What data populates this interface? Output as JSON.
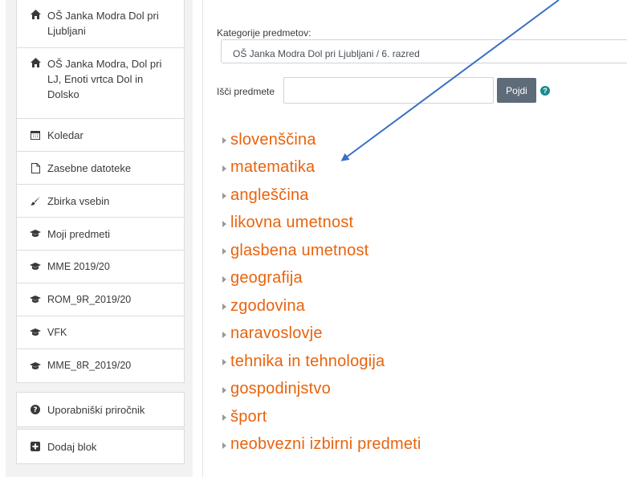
{
  "sidebar": {
    "items": [
      {
        "label": "OŠ Janka Modra Dol pri Ljubljani",
        "icon": "home-icon"
      },
      {
        "label": "OŠ Janka Modra, Dol pri LJ, Enoti vrtca Dol in Dolsko",
        "icon": "home-icon"
      },
      {
        "label": "Koledar",
        "icon": "calendar-icon"
      },
      {
        "label": "Zasebne datoteke",
        "icon": "file-icon"
      },
      {
        "label": "Zbirka vsebin",
        "icon": "paintbrush-icon"
      },
      {
        "label": "Moji predmeti",
        "icon": "graduation-cap-icon"
      },
      {
        "label": "MME 2019/20",
        "icon": "graduation-cap-icon"
      },
      {
        "label": "ROM_9R_2019/20",
        "icon": "graduation-cap-icon"
      },
      {
        "label": "VFK",
        "icon": "graduation-cap-icon"
      },
      {
        "label": "MME_8R_2019/20",
        "icon": "graduation-cap-icon"
      }
    ],
    "bottom_items": [
      {
        "label": "Uporabniški priročnik",
        "icon": "question-circle-icon"
      },
      {
        "label": "Dodaj blok",
        "icon": "plus-square-icon"
      }
    ]
  },
  "main": {
    "category_label": "Kategorije predmetov:",
    "category_value": "OŠ Janka Modra Dol pri Ljubljani / 6. razred",
    "search_label": "Išči predmete",
    "search_value": "",
    "search_button": "Pojdi",
    "courses": [
      "slovenščina",
      "matematika",
      "angleščina",
      "likovna umetnost",
      "glasbena umetnost",
      "geografija",
      "zgodovina",
      "naravoslovje",
      "tehnika in tehnologija",
      "gospodinjstvo",
      "šport",
      "neobvezni izbirni predmeti"
    ]
  },
  "colors": {
    "course_link": "#e8630d",
    "button_bg": "#5e6b78",
    "help_icon": "#1a8a91",
    "arrow": "#3a6fc4"
  }
}
